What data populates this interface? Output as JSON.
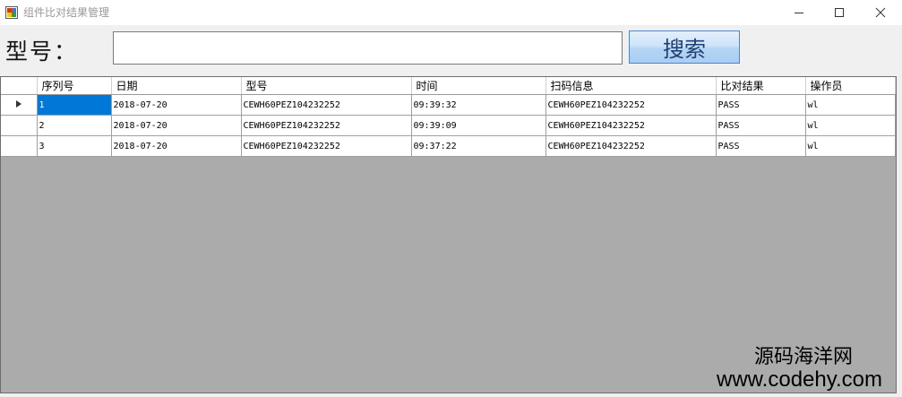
{
  "window": {
    "title": "组件比对结果管理"
  },
  "search": {
    "label": "型号：",
    "value": "",
    "placeholder": "",
    "button_label": "搜索"
  },
  "grid": {
    "columns": [
      "序列号",
      "日期",
      "型号",
      "时间",
      "扫码信息",
      "比对结果",
      "操作员"
    ],
    "rows": [
      [
        "1",
        "2018-07-20",
        "CEWH60PEZ104232252",
        "09:39:32",
        "CEWH60PEZ104232252",
        "PASS",
        "wl"
      ],
      [
        "2",
        "2018-07-20",
        "CEWH60PEZ104232252",
        "09:39:09",
        "CEWH60PEZ104232252",
        "PASS",
        "wl"
      ],
      [
        "3",
        "2018-07-20",
        "CEWH60PEZ104232252",
        "09:37:22",
        "CEWH60PEZ104232252",
        "PASS",
        "wl"
      ]
    ],
    "current_row": 1,
    "selection_color": "#0078d7",
    "background_color": "#ababab"
  },
  "watermark": {
    "line1": "源码海洋网",
    "line2": "www.codehy.com"
  },
  "icons": {
    "app": "app-icon",
    "minimize": "minimize-icon",
    "maximize": "maximize-icon",
    "close": "close-icon",
    "current_row": "current-row-arrow-icon"
  }
}
